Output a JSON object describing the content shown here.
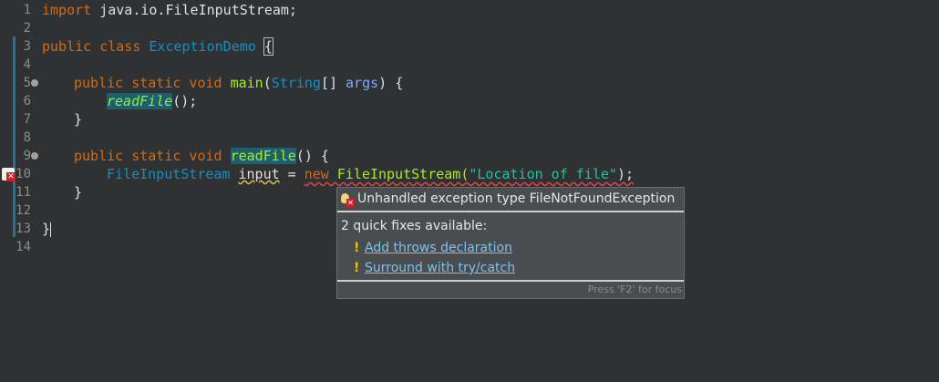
{
  "editor": {
    "line_numbers": [
      "1",
      "2",
      "3",
      "4",
      "5",
      "6",
      "7",
      "8",
      "9",
      "10",
      "11",
      "12",
      "13",
      "14"
    ],
    "lines": {
      "l1_kw": "import",
      "l1_rest": " java.io.FileInputStream;",
      "l3_kw": "public class",
      "l3_cls": "ExceptionDemo",
      "l3_brace": "{",
      "l5_kw": "public static void",
      "l5_meth": "main",
      "l5_p1": "(",
      "l5_type": "String",
      "l5_p2": "[] ",
      "l5_var": "args",
      "l5_p3": ") {",
      "l6_call": "readFile",
      "l6_rest": "();",
      "l7": "}",
      "l9_kw": "public static void",
      "l9_meth": "readFile",
      "l9_rest": "() {",
      "l10_type": "FileInputStream",
      "l10_var": "input",
      "l10_eq": " = ",
      "l10_new": "new",
      "l10_ctor": "FileInputStream(",
      "l10_str": "\"Location of file\"",
      "l10_end": ");",
      "l11": "}",
      "l13": "}"
    }
  },
  "popup": {
    "title": "Unhandled exception type FileNotFoundException",
    "subtitle": "2 quick fixes available:",
    "fixes": [
      "Add throws declaration",
      "Surround with try/catch"
    ],
    "footer": "Press 'F2' for focus"
  },
  "colors": {
    "background": "#2f3133",
    "keyword": "#cc6c1d",
    "class": "#1290c3",
    "string": "#17c6a3",
    "link": "#7cc2f0"
  }
}
